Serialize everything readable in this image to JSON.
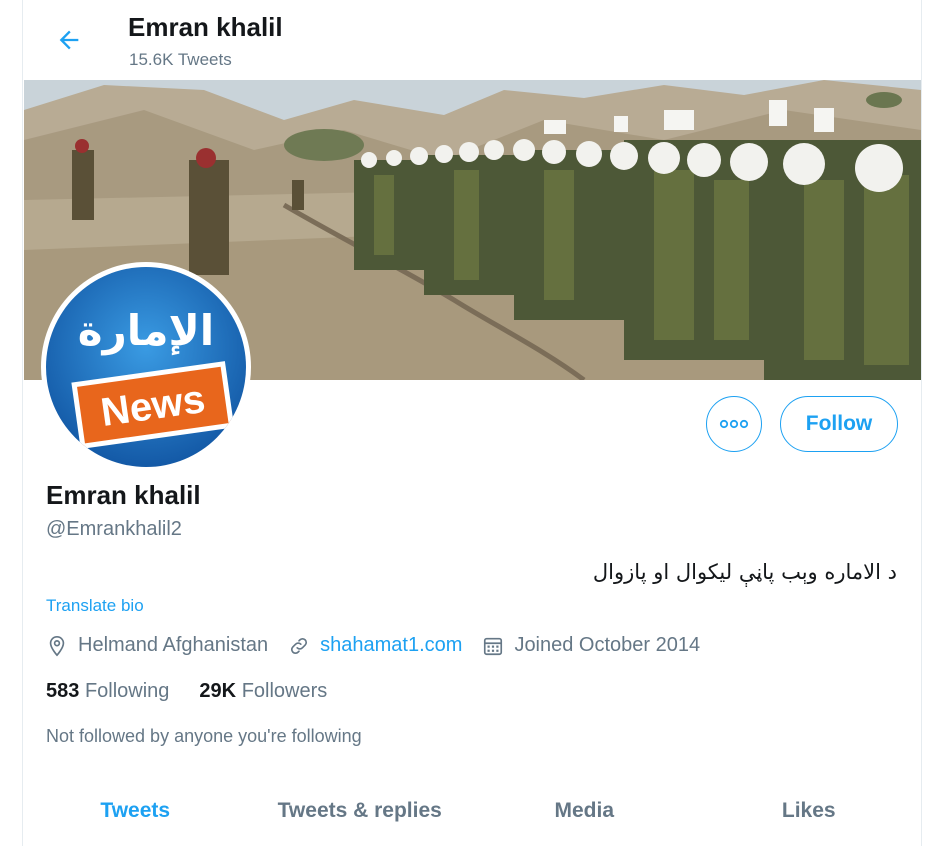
{
  "header": {
    "title": "Emran khalil",
    "subtitle": "15.6K Tweets"
  },
  "avatar": {
    "arabic_text": "الإمارة",
    "news_label": "News"
  },
  "actions": {
    "follow_label": "Follow"
  },
  "profile": {
    "name": "Emran khalil",
    "handle": "@Emrankhalil2",
    "bio": "د الاماره وېب پاڼې لیکوال او پازوال",
    "translate_label": "Translate bio",
    "location": "Helmand Afghanistan",
    "website": "shahamat1.com",
    "joined": "Joined October 2014",
    "following_count": "583",
    "following_label": "Following",
    "followers_count": "29K",
    "followers_label": "Followers",
    "not_followed_text": "Not followed by anyone you're following"
  },
  "tabs": [
    {
      "label": "Tweets",
      "active": true
    },
    {
      "label": "Tweets & replies",
      "active": false
    },
    {
      "label": "Media",
      "active": false
    },
    {
      "label": "Likes",
      "active": false
    }
  ],
  "colors": {
    "accent": "#1da1f2",
    "secondary_text": "#657786"
  }
}
